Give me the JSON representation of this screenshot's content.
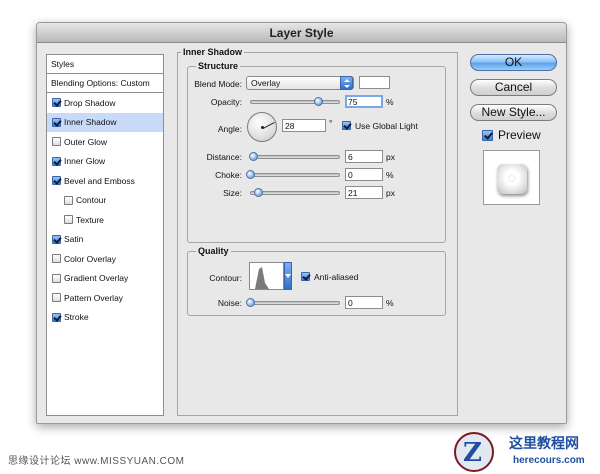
{
  "dialog": {
    "title": "Layer Style"
  },
  "styles_list": {
    "header": "Styles",
    "blending_options": "Blending Options: Custom",
    "items": [
      {
        "label": "Drop Shadow",
        "checked": true,
        "selected": false,
        "indent": false
      },
      {
        "label": "Inner Shadow",
        "checked": true,
        "selected": true,
        "indent": false
      },
      {
        "label": "Outer Glow",
        "checked": false,
        "selected": false,
        "indent": false
      },
      {
        "label": "Inner Glow",
        "checked": true,
        "selected": false,
        "indent": false
      },
      {
        "label": "Bevel and Emboss",
        "checked": true,
        "selected": false,
        "indent": false
      },
      {
        "label": "Contour",
        "checked": false,
        "selected": false,
        "indent": true
      },
      {
        "label": "Texture",
        "checked": false,
        "selected": false,
        "indent": true
      },
      {
        "label": "Satin",
        "checked": true,
        "selected": false,
        "indent": false
      },
      {
        "label": "Color Overlay",
        "checked": false,
        "selected": false,
        "indent": false
      },
      {
        "label": "Gradient Overlay",
        "checked": false,
        "selected": false,
        "indent": false
      },
      {
        "label": "Pattern Overlay",
        "checked": false,
        "selected": false,
        "indent": false
      },
      {
        "label": "Stroke",
        "checked": true,
        "selected": false,
        "indent": false
      }
    ]
  },
  "inner_shadow": {
    "section_title": "Inner Shadow",
    "structure": {
      "title": "Structure",
      "blend_mode_label": "Blend Mode:",
      "blend_mode_value": "Overlay",
      "opacity_label": "Opacity:",
      "opacity_value": "75",
      "opacity_unit": "%",
      "opacity_fraction": 0.75,
      "angle_label": "Angle:",
      "angle_value": "28",
      "angle_unit": "°",
      "use_global_light_label": "Use Global Light",
      "use_global_light": true,
      "distance_label": "Distance:",
      "distance_value": "6",
      "distance_unit": "px",
      "distance_fraction": 0.03,
      "choke_label": "Choke:",
      "choke_value": "0",
      "choke_unit": "%",
      "choke_fraction": 0.0,
      "size_label": "Size:",
      "size_value": "21",
      "size_unit": "px",
      "size_fraction": 0.09
    },
    "quality": {
      "title": "Quality",
      "contour_label": "Contour:",
      "anti_aliased_label": "Anti-aliased",
      "anti_aliased": true,
      "noise_label": "Noise:",
      "noise_value": "0",
      "noise_unit": "%",
      "noise_fraction": 0.0
    }
  },
  "buttons": {
    "ok": "OK",
    "cancel": "Cancel",
    "new_style": "New Style...",
    "preview_label": "Preview",
    "preview_checked": true
  },
  "watermark": {
    "left_text": "思缘设计论坛 www.MISSYUAN.COM",
    "brand_cn": "这里教程网",
    "brand_url": "herecours.com",
    "logo_letter": "Z"
  },
  "colors": {
    "accent": "#3d7fd4",
    "selection": "#c8daf8",
    "brand": "#1f4fa0"
  }
}
